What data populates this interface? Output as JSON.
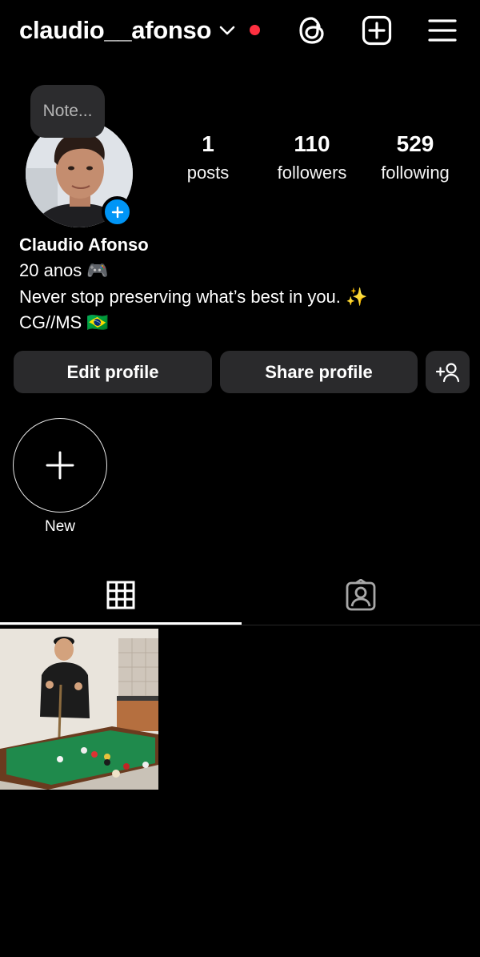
{
  "header": {
    "username": "claudio__afonso",
    "has_notification_dot": true,
    "icons": [
      "threads-icon",
      "create-icon",
      "menu-icon"
    ]
  },
  "profile": {
    "note_placeholder": "Note...",
    "stats": [
      {
        "value": "1",
        "label": "posts"
      },
      {
        "value": "110",
        "label": "followers"
      },
      {
        "value": "529",
        "label": "following"
      }
    ],
    "name": "Claudio Afonso",
    "bio_lines": [
      "20 anos 🎮",
      "Never stop preserving what’s best in you. ✨",
      "CG//MS 🇧🇷"
    ]
  },
  "actions": {
    "edit_label": "Edit profile",
    "share_label": "Share profile"
  },
  "highlights": {
    "new_label": "New"
  },
  "tabs": [
    "grid",
    "tagged"
  ],
  "colors": {
    "background": "#000000",
    "button": "#2a2a2c",
    "accent_blue": "#0095f6",
    "notification_red": "#ff3040"
  }
}
